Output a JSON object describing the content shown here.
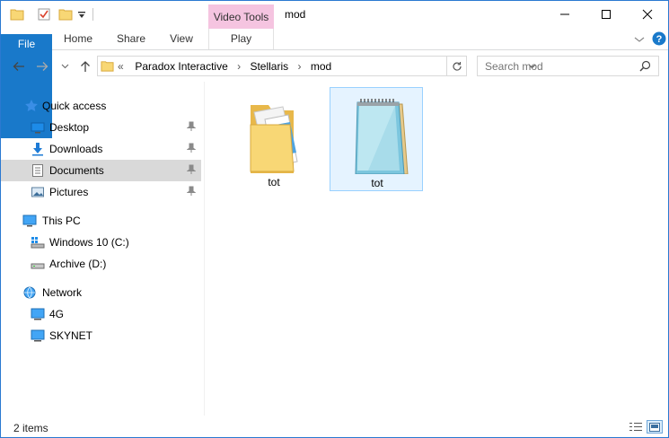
{
  "window": {
    "title": "mod"
  },
  "quick_access_toolbar": {
    "icons": [
      "folder-icon",
      "properties-checkmark-icon",
      "new-folder-icon",
      "customize-dropdown-icon"
    ]
  },
  "ribbon": {
    "contextual_header": "Video Tools",
    "tabs": [
      {
        "label": "File"
      },
      {
        "label": "Home"
      },
      {
        "label": "Share"
      },
      {
        "label": "View"
      },
      {
        "label": "Play"
      }
    ]
  },
  "address_bar": {
    "overflow": "«",
    "crumbs": [
      "Paradox Interactive",
      "Stellaris",
      "mod"
    ],
    "separator": "›"
  },
  "search": {
    "placeholder": "Search mod"
  },
  "nav_pane": {
    "quick_access": {
      "label": "Quick access",
      "items": [
        {
          "label": "Desktop",
          "icon": "desktop-icon",
          "pinned": true
        },
        {
          "label": "Downloads",
          "icon": "downloads-icon",
          "pinned": true
        },
        {
          "label": "Documents",
          "icon": "documents-icon",
          "pinned": true,
          "selected": true
        },
        {
          "label": "Pictures",
          "icon": "pictures-icon",
          "pinned": true
        }
      ]
    },
    "this_pc": {
      "label": "This PC",
      "items": [
        {
          "label": "Windows 10 (C:)",
          "icon": "windows-drive-icon"
        },
        {
          "label": "Archive (D:)",
          "icon": "drive-icon"
        }
      ]
    },
    "network": {
      "label": "Network",
      "items": [
        {
          "label": "4G",
          "icon": "computer-icon"
        },
        {
          "label": "SKYNET",
          "icon": "computer-icon"
        }
      ]
    }
  },
  "files": [
    {
      "name": "tot",
      "type": "folder",
      "icon": "folder-with-documents-icon",
      "selected": false
    },
    {
      "name": "tot",
      "type": "text-document",
      "icon": "notepad-document-icon",
      "selected": true
    }
  ],
  "status_bar": {
    "item_count": "2 items"
  },
  "colors": {
    "accent": "#1979ca",
    "contextual_tab": "#f5c4e0",
    "selection_fill": "#e5f3ff",
    "selection_border": "#99d1ff",
    "nav_selected": "#d9d9d9"
  }
}
